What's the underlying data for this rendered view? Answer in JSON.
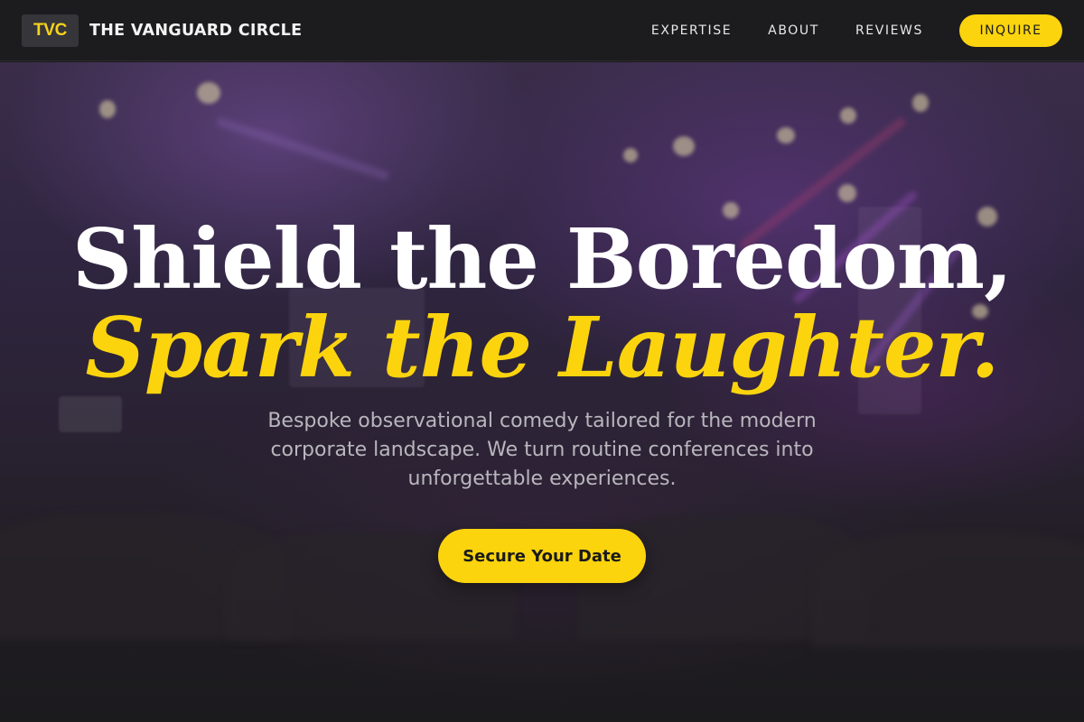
{
  "brand": {
    "logo": "TVC",
    "name": "THE VANGUARD CIRCLE"
  },
  "nav": {
    "links": [
      "EXPERTISE",
      "ABOUT",
      "REVIEWS"
    ],
    "cta": "INQUIRE"
  },
  "hero": {
    "headline_line1": "Shield the Boredom,",
    "headline_line2": "Spark the Laughter.",
    "subtitle": "Bespoke observational comedy tailored for the modern corporate landscape. We turn routine conferences into unforgettable experiences.",
    "cta": "Secure Your Date"
  },
  "colors": {
    "accent": "#fbd40e",
    "nav_bg": "#1c1b1e",
    "page_bg": "#1b1a1d"
  }
}
